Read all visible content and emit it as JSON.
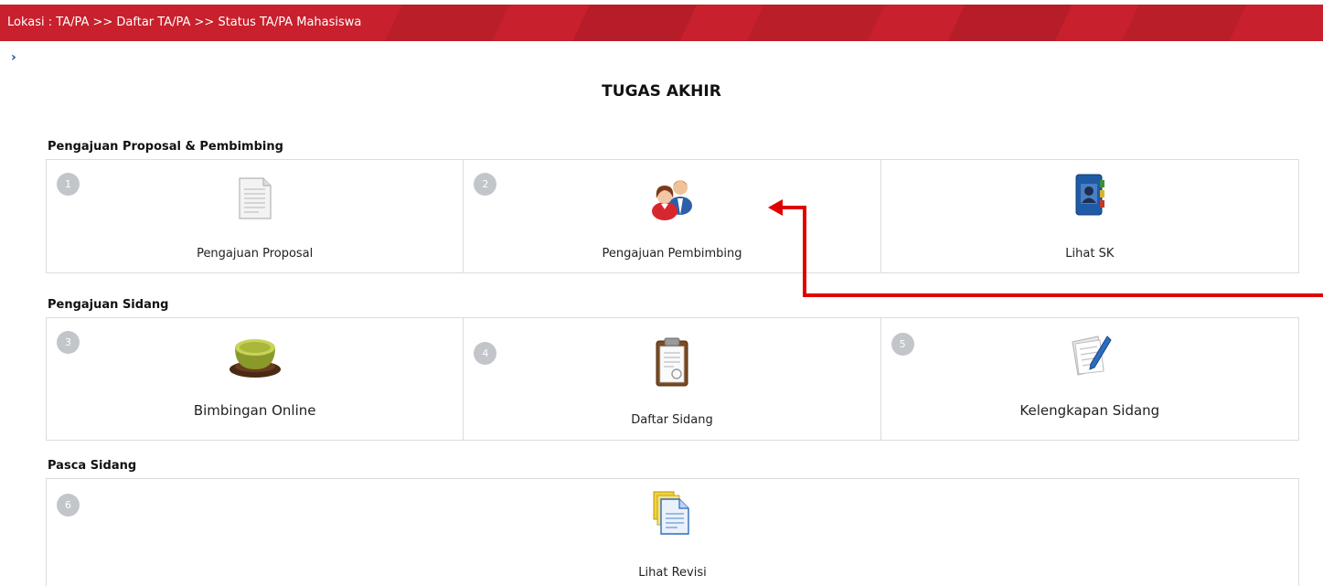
{
  "breadcrumb": {
    "text": "Lokasi : TA/PA >> Daftar TA/PA >> Status TA/PA Mahasiswa"
  },
  "sidebar_toggle": {
    "glyph": "›"
  },
  "page_title": "TUGAS AKHIR",
  "sections": [
    {
      "title": "Pengajuan Proposal & Pembimbing",
      "items": [
        {
          "number": "1",
          "label": "Pengajuan Proposal",
          "icon": "document-icon"
        },
        {
          "number": "2",
          "label": "Pengajuan Pembimbing",
          "icon": "people-icon"
        },
        {
          "number": "",
          "label": "Lihat SK",
          "icon": "address-book-icon"
        }
      ]
    },
    {
      "title": "Pengajuan Sidang",
      "items": [
        {
          "number": "3",
          "label": "Bimbingan Online",
          "icon": "tea-cup-icon"
        },
        {
          "number": "4",
          "label": "Daftar Sidang",
          "icon": "clipboard-icon"
        },
        {
          "number": "5",
          "label": "Kelengkapan Sidang",
          "icon": "notes-pencil-icon"
        }
      ]
    },
    {
      "title": "Pasca Sidang",
      "items": [
        {
          "number": "6",
          "label": "Lihat Revisi",
          "icon": "documents-stack-icon"
        }
      ]
    }
  ],
  "colors": {
    "topbar": "#c8202c",
    "badge": "#c2c5c9",
    "annotation_arrow": "#e00000",
    "border": "#dcdcdc"
  }
}
